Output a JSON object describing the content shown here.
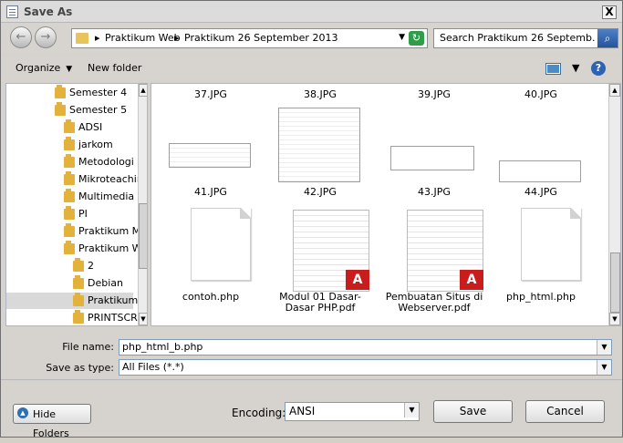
{
  "window": {
    "title": "Save As",
    "close": "X"
  },
  "navigation": {
    "back": "←",
    "forward": "→",
    "breadcrumbs": [
      "Praktikum Web",
      "Praktikum 26 September 2013"
    ],
    "search_placeholder": "Search Praktikum 26 Septemb..."
  },
  "toolbar": {
    "organize": "Organize",
    "new_folder": "New folder",
    "help": "?"
  },
  "tree": [
    {
      "label": "Semester 4"
    },
    {
      "label": "Semester 5"
    },
    {
      "label": "ADSI"
    },
    {
      "label": "jarkom"
    },
    {
      "label": "Metodologi P"
    },
    {
      "label": "Mikroteachin"
    },
    {
      "label": "Multimedia"
    },
    {
      "label": "PI"
    },
    {
      "label": "Praktikum Mu"
    },
    {
      "label": "Praktikum W"
    },
    {
      "label": "2"
    },
    {
      "label": "Debian"
    },
    {
      "label": "Praktikum"
    },
    {
      "label": "PRINTSCR"
    }
  ],
  "files": [
    {
      "label": "37.JPG"
    },
    {
      "label": "38.JPG"
    },
    {
      "label": "39.JPG"
    },
    {
      "label": "40.JPG"
    },
    {
      "label": "41.JPG"
    },
    {
      "label": "42.JPG"
    },
    {
      "label": "43.JPG"
    },
    {
      "label": "44.JPG"
    },
    {
      "label": "contoh.php"
    },
    {
      "label": "Modul 01 Dasar-Dasar PHP.pdf"
    },
    {
      "label": "Pembuatan Situs di Webserver.pdf"
    },
    {
      "label": "php_html.php"
    }
  ],
  "form": {
    "file_name_label": "File name:",
    "file_name_value": "php_html_b.php",
    "save_type_label": "Save as type:",
    "save_type_value": "All Files  (*.*)",
    "encoding_label": "Encoding:",
    "encoding_value": "ANSI",
    "hide_folders": "Hide Folders",
    "save": "Save",
    "cancel": "Cancel"
  },
  "icons": {
    "pdf_badge": "A"
  }
}
